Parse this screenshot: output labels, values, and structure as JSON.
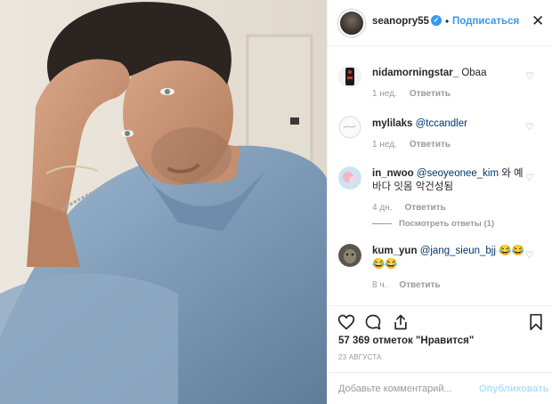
{
  "post": {
    "username": "seanopry55",
    "follow_label": "Подписаться",
    "separator": "•",
    "close_icon": "close-icon",
    "verified_icon": "verified-badge-icon"
  },
  "comments": [
    {
      "user": "nidamorningstar_",
      "text": "Obaa",
      "mention": "",
      "time": "1 нед.",
      "reply_label": "Ответить"
    },
    {
      "user": "mylilaks",
      "text": "",
      "mention": "@tccandler",
      "time": "1 нед.",
      "reply_label": "Ответить"
    },
    {
      "user": "in_nwoo",
      "text": "와 예바다 잇몸 악건성됨",
      "mention": "@seoyeonee_kim",
      "time": "4 дн.",
      "reply_label": "Ответить"
    },
    {
      "user": "kum_yun",
      "text": "😂😂😂😂",
      "mention": "@jang_sieun_bjj",
      "time": "8 ч.",
      "reply_label": "Ответить"
    }
  ],
  "view_replies_label": "Посмотреть ответы (1)",
  "likes_text": "57 369 отметок \"Нравится\"",
  "date_text": "23 АВГУСТА",
  "add_comment_placeholder": "Добавьте комментарий...",
  "publish_label": "Опубликовать",
  "icons": {
    "like": "heart-icon",
    "comment": "comment-icon",
    "share": "share-icon",
    "save": "bookmark-icon"
  },
  "colors": {
    "link": "#3897f0",
    "mention": "#003569",
    "meta": "#999999",
    "publish_disabled": "#b2dffc"
  }
}
